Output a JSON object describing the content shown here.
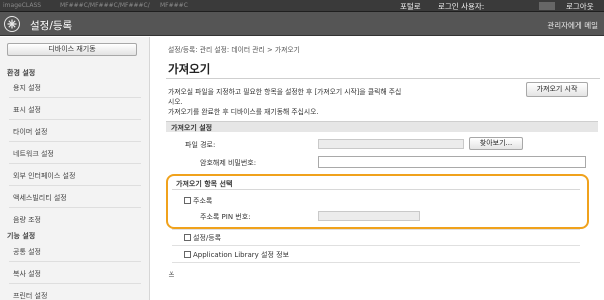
{
  "topbar": {
    "device_1": "imageCLASS",
    "device_2": "MF###C/MF###C/MF###C/",
    "device_3": "MF###C",
    "portal_link": "포털로",
    "login_user_label": "로그인 사용자:",
    "logout_link": "로그아웃"
  },
  "header": {
    "title": "설정/등록",
    "mail_link": "관리자에게 메일"
  },
  "sidebar": {
    "restart_button": "디바이스 재기동",
    "section_env": "환경 설정",
    "env_items": [
      "용지 설정",
      "표시 설정",
      "타이머 설정",
      "네트워크 설정",
      "외부 인터페이스 설정",
      "액세스빌리티 설정",
      "음량 조정"
    ],
    "section_func": "기능 설정",
    "func_items": [
      "공통 설정",
      "복사 설정",
      "프린터 설정"
    ]
  },
  "breadcrumb": "설정/등록: 관리 설정: 데이터 관리 > 가져오기",
  "page_title": "가져오기",
  "import_button": "가져오기 시작",
  "description": {
    "line1": "가져오실 파일을 지정하고 필요한 항목을 설정한 후 [가져오기 시작]을 클릭해 주십",
    "line2": "시오.",
    "line3": "가져오기를 완료한 후 디바이스를 재기동해 주십시오."
  },
  "import_settings": {
    "heading": "가져오기 설정",
    "file_path_label": "파일 경로:",
    "browse_button": "찾아보기...",
    "decrypt_password_label": "암호해제 비밀번호:"
  },
  "import_items": {
    "heading": "가져오기 항목 선택",
    "address_book_label": "주소록",
    "address_pin_label": "주소록 PIN 번호:",
    "settings_label": "설정/등록",
    "app_library_label": "Application Library 설정 정보"
  },
  "top_link": "≚"
}
